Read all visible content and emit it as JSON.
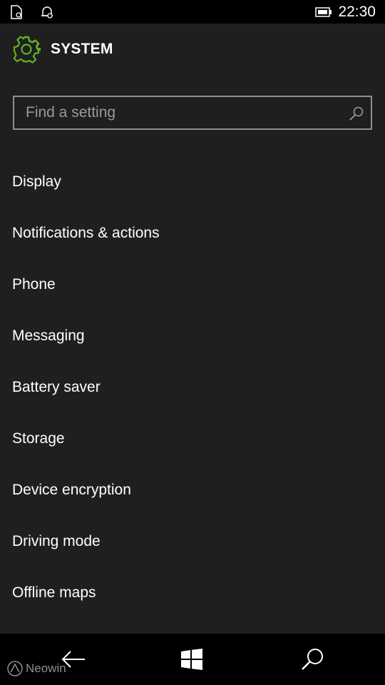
{
  "status_bar": {
    "time": "22:30",
    "icons": [
      "sim-card-icon",
      "alarm-icon",
      "battery-icon"
    ]
  },
  "header": {
    "title": "SYSTEM",
    "icon": "gear-icon",
    "accent_color": "#5fb320"
  },
  "search": {
    "placeholder": "Find a setting",
    "value": "",
    "icon": "search-icon"
  },
  "menu": {
    "items": [
      {
        "label": "Display"
      },
      {
        "label": "Notifications & actions"
      },
      {
        "label": "Phone"
      },
      {
        "label": "Messaging"
      },
      {
        "label": "Battery saver"
      },
      {
        "label": "Storage"
      },
      {
        "label": "Device encryption"
      },
      {
        "label": "Driving mode"
      },
      {
        "label": "Offline maps"
      }
    ]
  },
  "nav_bar": {
    "buttons": [
      "back-arrow-icon",
      "windows-start-icon",
      "search-icon"
    ]
  },
  "watermark": {
    "text": "Neowin"
  }
}
